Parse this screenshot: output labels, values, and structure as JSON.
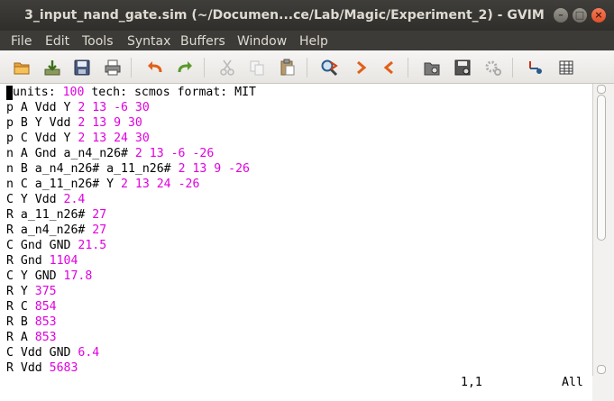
{
  "window": {
    "title": "3_input_nand_gate.sim (~/Documen...ce/Lab/Magic/Experiment_2) - GVIM",
    "minimize_glyph": "–",
    "maximize_glyph": "□",
    "close_glyph": "×"
  },
  "menu": [
    "File",
    "Edit",
    "Tools",
    "Syntax",
    "Buffers",
    "Window",
    "Help"
  ],
  "toolbar_icons": [
    "open-icon",
    "save-download-icon",
    "save-icon",
    "print-icon",
    "undo-icon",
    "redo-icon",
    "cut-icon",
    "copy-icon",
    "paste-icon",
    "find-replace-icon",
    "find-next-icon",
    "find-prev-icon",
    "load-session-icon",
    "save-session-icon",
    "run-script-icon",
    "make-icon",
    "table-icon"
  ],
  "editor": {
    "lines": [
      [
        {
          "t": "units: "
        },
        {
          "t": "100",
          "n": true
        },
        {
          "t": " tech: scmos format: MIT"
        }
      ],
      [
        {
          "t": "p A Vdd Y "
        },
        {
          "t": "2 13 -6 30",
          "n": true
        }
      ],
      [
        {
          "t": "p B Y Vdd "
        },
        {
          "t": "2 13 9 30",
          "n": true
        }
      ],
      [
        {
          "t": "p C Vdd Y "
        },
        {
          "t": "2 13 24 30",
          "n": true
        }
      ],
      [
        {
          "t": "n A Gnd a_n4_n26# "
        },
        {
          "t": "2 13 -6 -26",
          "n": true
        }
      ],
      [
        {
          "t": "n B a_n4_n26# a_11_n26# "
        },
        {
          "t": "2 13 9 -26",
          "n": true
        }
      ],
      [
        {
          "t": "n C a_11_n26# Y "
        },
        {
          "t": "2 13 24 -26",
          "n": true
        }
      ],
      [
        {
          "t": "C Y Vdd "
        },
        {
          "t": "2.4",
          "n": true
        }
      ],
      [
        {
          "t": "R a_11_n26# "
        },
        {
          "t": "27",
          "n": true
        }
      ],
      [
        {
          "t": "R a_n4_n26# "
        },
        {
          "t": "27",
          "n": true
        }
      ],
      [
        {
          "t": "C Gnd GND "
        },
        {
          "t": "21.5",
          "n": true
        }
      ],
      [
        {
          "t": "R Gnd "
        },
        {
          "t": "1104",
          "n": true
        }
      ],
      [
        {
          "t": "C Y GND "
        },
        {
          "t": "17.8",
          "n": true
        }
      ],
      [
        {
          "t": "R Y "
        },
        {
          "t": "375",
          "n": true
        }
      ],
      [
        {
          "t": "R C "
        },
        {
          "t": "854",
          "n": true
        }
      ],
      [
        {
          "t": "R B "
        },
        {
          "t": "853",
          "n": true
        }
      ],
      [
        {
          "t": "R A "
        },
        {
          "t": "853",
          "n": true
        }
      ],
      [
        {
          "t": "C Vdd GND "
        },
        {
          "t": "6.4",
          "n": true
        }
      ],
      [
        {
          "t": "R Vdd "
        },
        {
          "t": "5683",
          "n": true
        }
      ]
    ],
    "number_color": "#e000e0"
  },
  "status": {
    "position": "1,1",
    "scroll": "All"
  }
}
